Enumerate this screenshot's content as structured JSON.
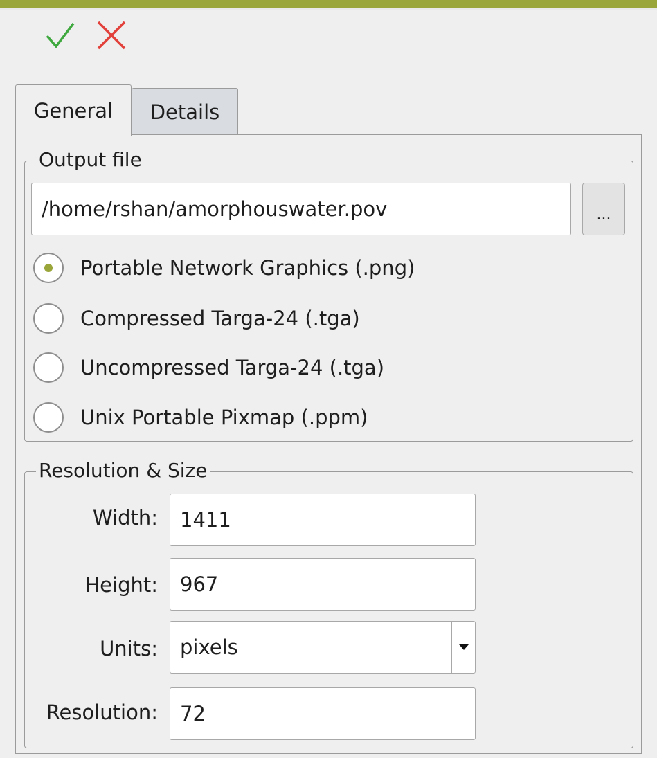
{
  "toolbar": {
    "accept_icon": "checkmark-icon",
    "cancel_icon": "close-icon",
    "accept_color": "#3fa93f",
    "cancel_color": "#e2403a"
  },
  "tabs": [
    {
      "label": "General",
      "active": true
    },
    {
      "label": "Details",
      "active": false
    }
  ],
  "output_file": {
    "title": "Output file",
    "path": "/home/rshan/amorphouswater.pov",
    "browse_label": "...",
    "formats": [
      {
        "label": "Portable Network Graphics (.png)",
        "selected": true
      },
      {
        "label": "Compressed Targa-24 (.tga)",
        "selected": false
      },
      {
        "label": "Uncompressed Targa-24 (.tga)",
        "selected": false
      },
      {
        "label": "Unix Portable Pixmap (.ppm)",
        "selected": false
      }
    ]
  },
  "resolution_size": {
    "title": "Resolution & Size",
    "width_label": "Width:",
    "width_value": "1411",
    "height_label": "Height:",
    "height_value": "967",
    "units_label": "Units:",
    "units_value": "pixels",
    "resolution_label": "Resolution:",
    "resolution_value": "72"
  },
  "colors": {
    "accent": "#9aa53a"
  }
}
